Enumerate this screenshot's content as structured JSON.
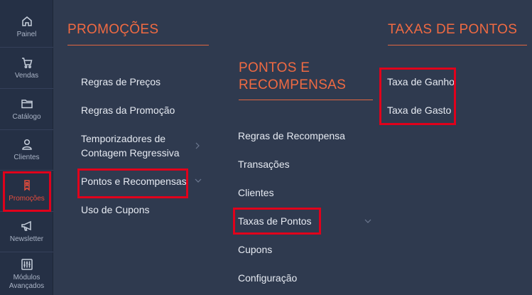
{
  "leftnav": {
    "items": [
      {
        "label": "Painel",
        "icon": "home-icon"
      },
      {
        "label": "Vendas",
        "icon": "cart-icon"
      },
      {
        "label": "Catálogo",
        "icon": "folder-icon"
      },
      {
        "label": "Clientes",
        "icon": "user-icon"
      },
      {
        "label": "Promoções",
        "icon": "tag-icon"
      },
      {
        "label": "Newsletter",
        "icon": "megaphone-icon"
      },
      {
        "label": "Módulos Avançados",
        "icon": "sliders-icon"
      }
    ],
    "active_index": 4
  },
  "promocoes": {
    "title": "PROMOÇÕES",
    "items": [
      {
        "label": "Regras de Preços"
      },
      {
        "label": "Regras da Promoção"
      },
      {
        "label": "Temporizadores de Contagem Regressiva"
      },
      {
        "label": "Pontos e Recompensas"
      },
      {
        "label": "Uso de Cupons"
      }
    ]
  },
  "pontos": {
    "title": "PONTOS E RECOMPENSAS",
    "items": [
      {
        "label": "Regras de Recompensa"
      },
      {
        "label": "Transações"
      },
      {
        "label": "Clientes"
      },
      {
        "label": "Taxas de Pontos"
      },
      {
        "label": "Cupons"
      },
      {
        "label": "Configuração"
      }
    ]
  },
  "taxas": {
    "title": "TAXAS DE PONTOS",
    "items": [
      {
        "label": "Taxa de Ganho"
      },
      {
        "label": "Taxa de Gasto"
      }
    ]
  },
  "colors": {
    "accent": "#f06a42",
    "highlight": "#e0001b",
    "background": "#2f3a4f",
    "sidebar": "#253045"
  }
}
